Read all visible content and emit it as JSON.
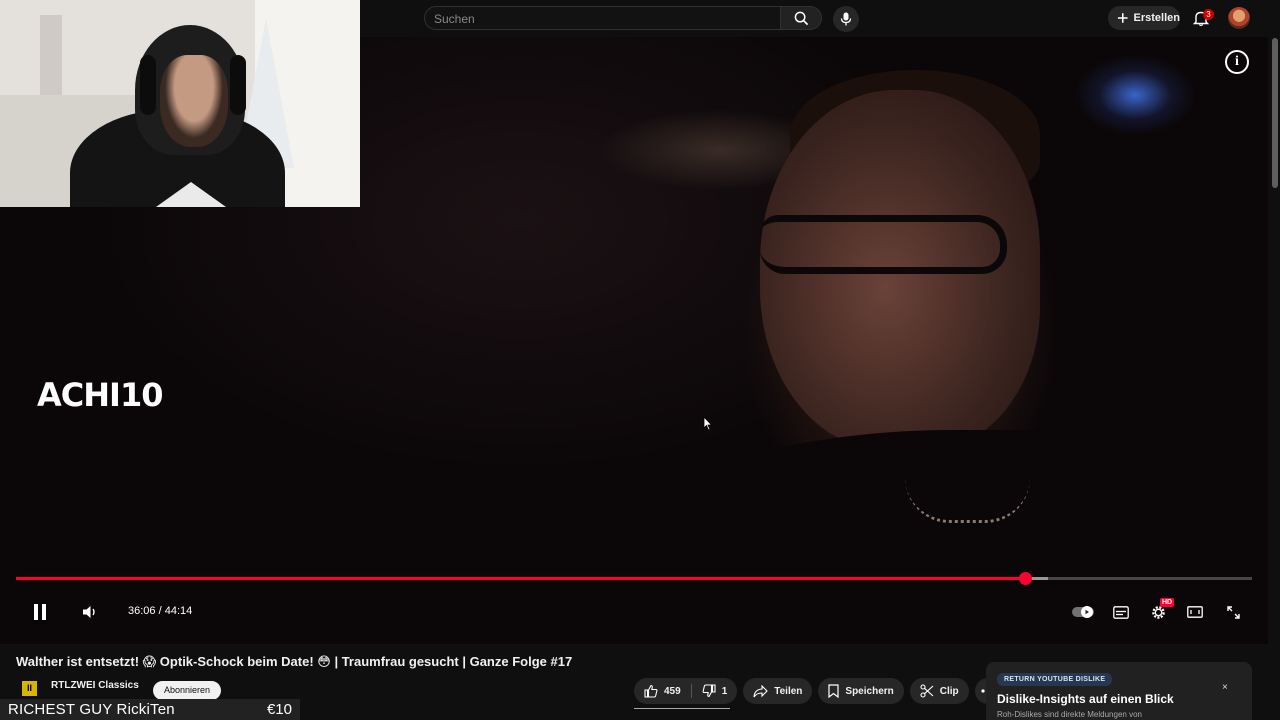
{
  "search": {
    "placeholder": "Suchen"
  },
  "header": {
    "create_label": "Erstellen",
    "notification_count": "3"
  },
  "video": {
    "overlay_text": "ACHI10",
    "current_time": "36:06",
    "duration": "44:14",
    "time_separator": "/",
    "progress": 0.816,
    "buffered": 0.835,
    "quality_badge": "HD"
  },
  "info": {
    "title": "Walther ist entsetzt! 😱 Optik-Schock beim Date! 😳 | Traumfrau gesucht | Ganze Folge #17",
    "channel_name": "RTLZWEI Classics",
    "channel_logo_text": "II",
    "subscribe_label": "Abonnieren",
    "likes": "459",
    "dislikes": "1",
    "share_label": "Teilen",
    "save_label": "Speichern",
    "clip_label": "Clip"
  },
  "return_dislike": {
    "badge": "RETURN YOUTUBE DISLIKE",
    "title": "Dislike-Insights auf einen Blick",
    "subtitle": "Roh-Dislikes sind direkte Meldungen von",
    "close": "×"
  },
  "donation": {
    "name": "RICHEST GUY RickiTen",
    "amount": "€10"
  },
  "colors": {
    "accent": "#ff0033",
    "background": "#0f0f0f",
    "pill": "#272727"
  }
}
